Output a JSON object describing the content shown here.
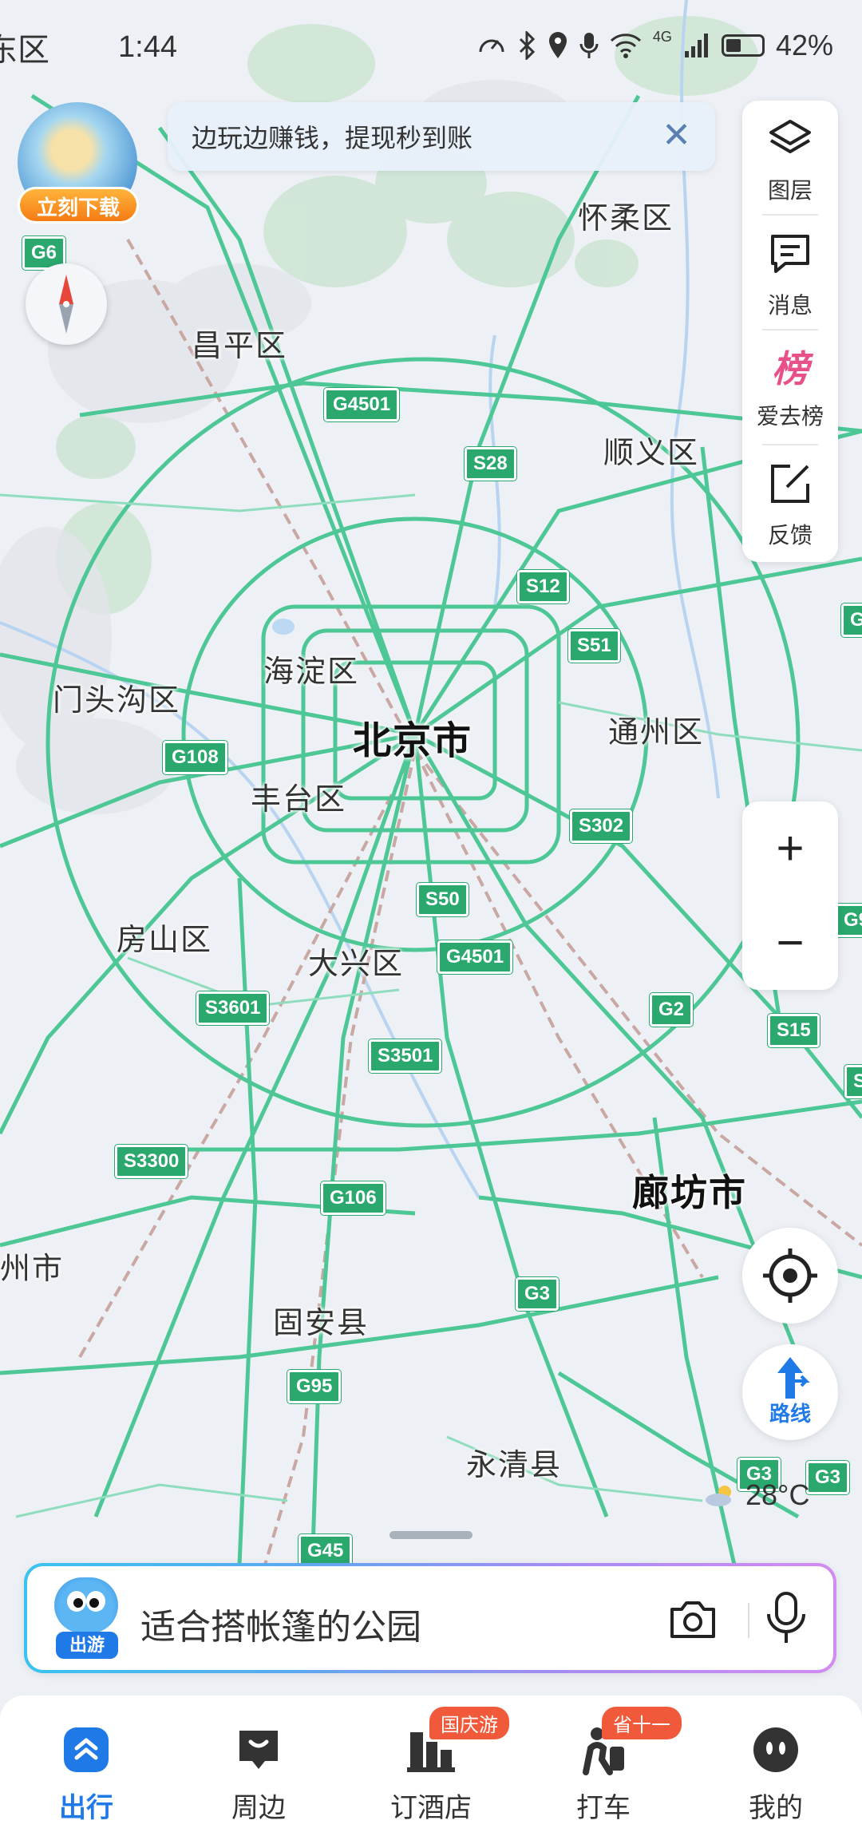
{
  "status_bar": {
    "time": "1:44",
    "left_fragment": "东区",
    "network": "4G",
    "battery_percent": "42%",
    "battery_level": 0.42
  },
  "banner": {
    "text": "边玩边赚钱，提现秒到账",
    "close": "✕"
  },
  "promo": {
    "button": "立刻下载"
  },
  "side_panel": {
    "items": [
      {
        "label": "图层",
        "icon": "layers-icon"
      },
      {
        "label": "消息",
        "icon": "message-icon"
      },
      {
        "label": "爱去榜",
        "icon": "ranking-icon",
        "glyph": "榜"
      },
      {
        "label": "反馈",
        "icon": "feedback-icon"
      }
    ]
  },
  "zoom": {
    "plus": "+",
    "minus": "−"
  },
  "route": {
    "label": "路线"
  },
  "weather": {
    "temp": "28°C"
  },
  "map": {
    "cities": [
      "北京市",
      "廊坊市"
    ],
    "districts": [
      "怀柔区",
      "昌平区",
      "顺义区",
      "海淀区",
      "门头沟区",
      "通州区",
      "丰台区",
      "房山区",
      "大兴区",
      "固安县",
      "永清县",
      "州市",
      "东区"
    ],
    "highways": [
      "G6",
      "G4501",
      "S28",
      "S12",
      "S51",
      "G108",
      "S302",
      "S50",
      "G4501",
      "G2",
      "S3601",
      "S3501",
      "S15",
      "S3300",
      "G106",
      "G3",
      "G95",
      "G3",
      "G3",
      "G45",
      "G",
      "G95",
      "S"
    ]
  },
  "search": {
    "placeholder": "适合搭帐篷的公园",
    "mascot_label": "出游"
  },
  "tabs": [
    {
      "label": "出行",
      "badge": ""
    },
    {
      "label": "周边",
      "badge": ""
    },
    {
      "label": "订酒店",
      "badge": "国庆游"
    },
    {
      "label": "打车",
      "badge": "省十一"
    },
    {
      "label": "我的",
      "badge": ""
    }
  ],
  "colors": {
    "road": "#4cc795",
    "accent_blue": "#1f7ae8",
    "badge_red": "#f05a3a",
    "highway_shield": "#2aa86e"
  }
}
